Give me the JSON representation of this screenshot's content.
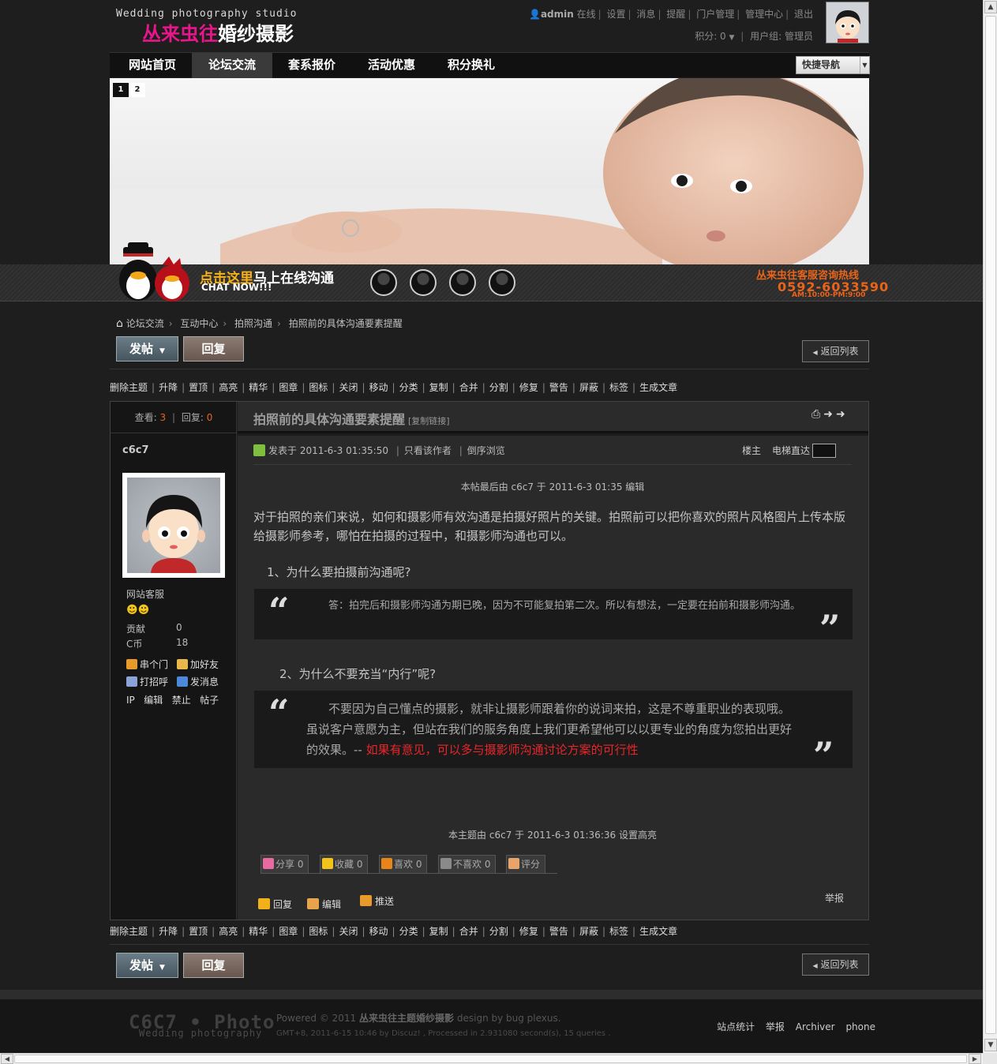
{
  "header": {
    "logo_en": "Wedding photography studio",
    "logo_cn_pink": "丛来虫往",
    "logo_cn_white": "婚纱摄影",
    "user": {
      "name": "admin",
      "online": "在线",
      "links": [
        "设置",
        "消息",
        "提醒",
        "门户管理",
        "管理中心",
        "退出"
      ],
      "points": "积分: 0",
      "group": "用户组: 管理员"
    }
  },
  "nav": {
    "items": [
      "网站首页",
      "论坛交流",
      "套系报价",
      "活动优惠",
      "积分换礼"
    ],
    "active_index": 1,
    "quicknav": "快捷导航"
  },
  "banner": {
    "slides": [
      "1",
      "2"
    ],
    "active_slide": 0
  },
  "chatbar": {
    "title_orange": "点击这里",
    "title_white": "马上在线沟通",
    "subtitle": "CHAT NOW!!!",
    "hotline_label": "丛来虫往客服咨询热线",
    "hotline_number": "0592-6033590",
    "hotline_hours": "AM:10:00-PM:9:00"
  },
  "breadcrumb": [
    "论坛交流",
    "互动中心",
    "拍照沟通",
    "拍照前的具体沟通要素提醒"
  ],
  "buttons": {
    "post": "发帖",
    "reply": "回复",
    "back": "返回列表"
  },
  "modbar": [
    "删除主题",
    "升降",
    "置顶",
    "高亮",
    "精华",
    "图章",
    "图标",
    "关闭",
    "移动",
    "分类",
    "复制",
    "合并",
    "分割",
    "修复",
    "警告",
    "屏蔽",
    "标签",
    "生成文章"
  ],
  "thread": {
    "views_label": "查看:",
    "views": "3",
    "replies_label": "回复:",
    "replies": "0",
    "title": "拍照前的具体沟通要素提醒",
    "copy_link": "[复制链接]"
  },
  "author": {
    "name": "c6c7",
    "title": "网站客服",
    "stats": [
      {
        "label": "贡献",
        "value": "0"
      },
      {
        "label": "C币",
        "value": "18"
      }
    ],
    "actions": [
      "串个门",
      "加好友",
      "打招呼",
      "发消息"
    ],
    "admin_links": [
      "IP",
      "编辑",
      "禁止",
      "帖子"
    ]
  },
  "post": {
    "posted_at": "发表于 2011-6-3 01:35:50",
    "only_author": "只看该作者",
    "reverse": "倒序浏览",
    "floor": "楼主",
    "jump": "电梯直达",
    "edit_note": "本帖最后由 c6c7 于 2011-6-3 01:35 编辑",
    "para1": "对于拍照的亲们来说，如何和摄影师有效沟通是拍摄好照片的关键。拍照前可以把你喜欢的照片风格图片上传本版给摄影师参考，哪怕在拍摄的过程中，和摄影师沟通也可以。",
    "q1_head": "1、为什么要拍摄前沟通呢?",
    "q1_text": "答：拍完后和摄影师沟通为期已晚，因为不可能复拍第二次。所以有想法，一定要在拍前和摄影师沟通。",
    "q2_head": "2、为什么不要充当“内行”呢?",
    "q2_text": "不要因为自己懂点的摄影，就非让摄影师跟着你的说词来拍，这是不尊重职业的表现哦。虽说客户意愿为主，但站在我们的服务角度上我们更希望他可以以更专业的角度为您拍出更好的效果。--",
    "q2_red": "如果有意见，可以多与摄影师沟通讨论方案的可行性",
    "mod_note": "本主题由 c6c7 于 2011-6-3 01:36:36 设置高亮",
    "rate_buttons": [
      "分享 0",
      "收藏 0",
      "喜欢 0",
      "不喜欢 0",
      "评分"
    ],
    "post_actions": [
      "回复",
      "编辑",
      "推送"
    ],
    "report": "举报"
  },
  "footer": {
    "logo": "C6C7 • Photo",
    "logo_sub": "Wedding photography",
    "powered_prefix": "Powered © 2011",
    "powered_name": "丛来虫往主题婚纱摄影",
    "powered_suffix": "design by bug plexus.",
    "gmt": "GMT+8, 2011-6-15 10:46 by Discuz! , Processed in 2.931080 second(s), 15 queries .",
    "links": [
      "站点统计",
      "举报",
      "Archiver",
      "phone"
    ]
  },
  "colors": {
    "accent_orange": "#e8641b",
    "logo_pink": "#e8168a",
    "highlight_red": "#e8262a"
  }
}
